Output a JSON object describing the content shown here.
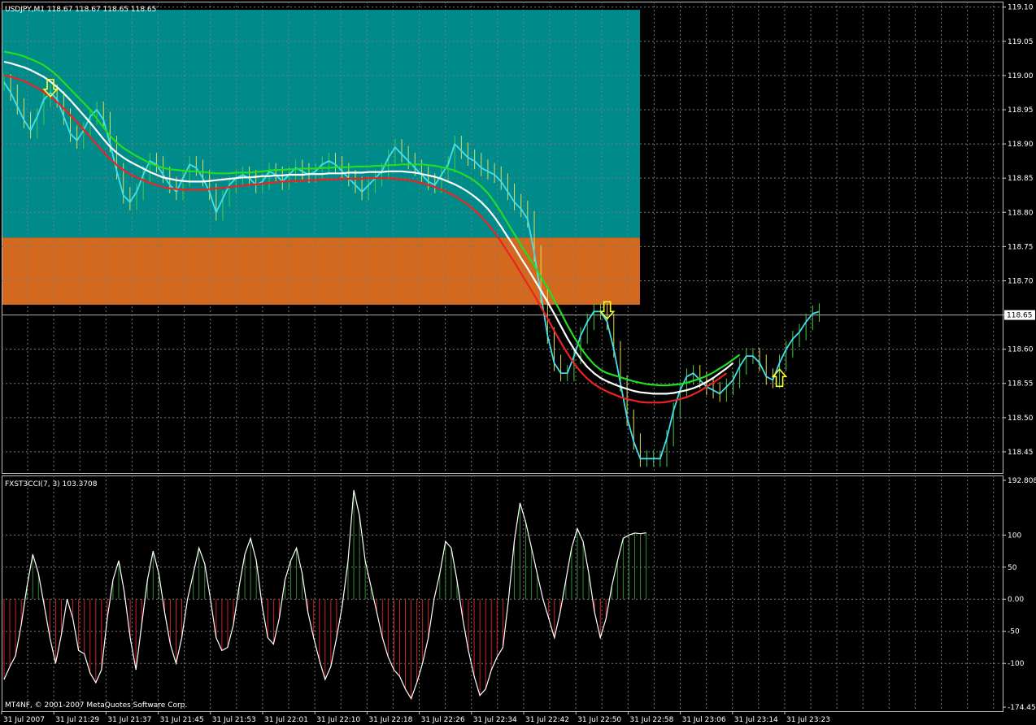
{
  "window": {
    "symbol_label": "USDJPY,M1  118.67 118.67 118.65 118.65",
    "indicator_label": "FXST3CCI(7, 3) 103.3708",
    "copyright": "MT4NF, © 2001-2007 MetaQuotes Software Corp."
  },
  "colors": {
    "background": "#000000",
    "grid": "#7a7a7a",
    "zone_upper": "#008b8b",
    "zone_lower": "#d2691e",
    "price_line": "#40e0f0",
    "ma_upper": "#22dd22",
    "ma_middle": "#ffffff",
    "ma_lower": "#ee2222",
    "bar_up": "#44cc44",
    "cci_line": "#ffffff",
    "cci_pos_hist": "#2e8b2e",
    "cci_neg_hist": "#cc2222",
    "arrow": "#ffff33"
  },
  "current_price_tag": "118.65",
  "price_axis": [
    "119.10",
    "119.05",
    "119.00",
    "118.95",
    "118.90",
    "118.85",
    "118.80",
    "118.75",
    "118.70",
    "118.65",
    "118.60",
    "118.55",
    "118.50",
    "118.45"
  ],
  "cci_axis": [
    "192.8083",
    "100",
    "50",
    "0.00",
    "-50",
    "-100",
    "-174.450"
  ],
  "time_axis": [
    "31 Jul 2007",
    "31 Jul 21:29",
    "31 Jul 21:37",
    "31 Jul 21:45",
    "31 Jul 21:53",
    "31 Jul 22:01",
    "31 Jul 22:10",
    "31 Jul 22:18",
    "31 Jul 22:26",
    "31 Jul 22:34",
    "31 Jul 22:42",
    "31 Jul 22:50",
    "31 Jul 22:58",
    "31 Jul 23:06",
    "31 Jul 23:14",
    "31 Jul 23:23"
  ],
  "chart_data": [
    {
      "type": "line",
      "title": "USDJPY,M1  118.67 118.67 118.65 118.65",
      "ylim": [
        118.419,
        119.108
      ],
      "zones": [
        {
          "name": "upper",
          "y_from": 119.096,
          "y_to": 118.763
        },
        {
          "name": "lower",
          "y_from": 118.763,
          "y_to": 118.665
        }
      ],
      "signals": [
        {
          "bar": 7,
          "price": 118.98,
          "direction": "down"
        },
        {
          "bar": 91,
          "price": 118.655,
          "direction": "down"
        },
        {
          "bar": 117,
          "price": 118.56,
          "direction": "up"
        }
      ],
      "series": [
        {
          "role": "price",
          "values": [
            118.99,
            118.975,
            118.955,
            118.935,
            118.92,
            118.94,
            118.965,
            118.975,
            118.965,
            118.94,
            118.915,
            118.905,
            118.92,
            118.94,
            118.95,
            118.935,
            118.9,
            118.86,
            118.825,
            118.815,
            118.83,
            118.855,
            118.875,
            118.87,
            118.855,
            118.84,
            118.83,
            118.85,
            118.87,
            118.865,
            118.85,
            118.83,
            118.8,
            118.82,
            118.84,
            118.85,
            118.855,
            118.85,
            118.84,
            118.845,
            118.86,
            118.855,
            118.845,
            118.855,
            118.865,
            118.86,
            118.855,
            118.86,
            118.87,
            118.875,
            118.87,
            118.86,
            118.85,
            118.84,
            118.83,
            118.84,
            118.85,
            118.86,
            118.88,
            118.895,
            118.885,
            118.875,
            118.865,
            118.855,
            118.845,
            118.84,
            118.855,
            118.87,
            118.9,
            118.89,
            118.88,
            118.875,
            118.865,
            118.86,
            118.855,
            118.845,
            118.83,
            118.815,
            118.805,
            118.79,
            118.74,
            118.68,
            118.62,
            118.58,
            118.565,
            118.565,
            118.59,
            118.62,
            118.64,
            118.655,
            118.655,
            118.64,
            118.6,
            118.55,
            118.5,
            118.465,
            118.44,
            118.44,
            118.44,
            118.44,
            118.47,
            118.51,
            118.54,
            118.56,
            118.565,
            118.555,
            118.545,
            118.54,
            118.535,
            118.545,
            118.555,
            118.575,
            118.59,
            118.59,
            118.58,
            118.56,
            118.555,
            118.58,
            118.6,
            118.615,
            118.625,
            118.64,
            118.652,
            118.655
          ]
        },
        {
          "role": "ma_upper",
          "values": [
            119.035,
            119.033,
            119.031,
            119.028,
            119.024,
            119.02,
            119.015,
            119.008,
            119.0,
            118.99,
            118.98,
            118.97,
            118.96,
            118.95,
            118.937,
            118.924,
            118.912,
            118.902,
            118.894,
            118.888,
            118.882,
            118.877,
            118.872,
            118.868,
            118.865,
            118.863,
            118.862,
            118.861,
            118.86,
            118.86,
            118.859,
            118.858,
            118.857,
            118.857,
            118.857,
            118.858,
            118.858,
            118.858,
            118.859,
            118.86,
            118.861,
            118.862,
            118.862,
            118.863,
            118.863,
            118.864,
            118.864,
            118.864,
            118.865,
            118.865,
            118.866,
            118.866,
            118.866,
            118.867,
            118.867,
            118.867,
            118.868,
            118.868,
            118.869,
            118.869,
            118.87,
            118.87,
            118.87,
            118.87,
            118.869,
            118.868,
            118.866,
            118.864,
            118.861,
            118.857,
            118.852,
            118.846,
            118.838,
            118.828,
            118.815,
            118.8,
            118.784,
            118.768,
            118.752,
            118.737,
            118.722,
            118.706,
            118.69,
            118.672,
            118.654,
            118.635,
            118.618,
            118.602,
            118.589,
            118.578,
            118.57,
            118.565,
            118.562,
            118.559,
            118.556,
            118.553,
            118.551,
            118.549,
            118.548,
            118.547,
            118.547,
            118.548,
            118.549,
            118.551,
            118.554,
            118.557,
            118.561,
            118.566,
            118.572,
            118.578,
            118.585,
            118.592
          ]
        },
        {
          "role": "ma_middle",
          "values": [
            119.02,
            119.018,
            119.015,
            119.012,
            119.008,
            119.003,
            118.998,
            118.991,
            118.983,
            118.974,
            118.964,
            118.953,
            118.942,
            118.931,
            118.919,
            118.907,
            118.896,
            118.887,
            118.88,
            118.874,
            118.869,
            118.864,
            118.859,
            118.855,
            118.851,
            118.849,
            118.847,
            118.846,
            118.845,
            118.845,
            118.845,
            118.846,
            118.847,
            118.848,
            118.849,
            118.85,
            118.851,
            118.851,
            118.852,
            118.853,
            118.853,
            118.854,
            118.854,
            118.855,
            118.855,
            118.855,
            118.856,
            118.856,
            118.856,
            118.857,
            118.857,
            118.857,
            118.858,
            118.858,
            118.858,
            118.859,
            118.859,
            118.859,
            118.86,
            118.86,
            118.86,
            118.859,
            118.858,
            118.856,
            118.854,
            118.852,
            118.849,
            118.845,
            118.841,
            118.836,
            118.83,
            118.823,
            118.815,
            118.805,
            118.793,
            118.779,
            118.764,
            118.749,
            118.733,
            118.718,
            118.702,
            118.686,
            118.669,
            118.652,
            118.634,
            118.616,
            118.6,
            118.586,
            118.574,
            118.565,
            118.558,
            118.553,
            118.549,
            118.545,
            118.542,
            118.539,
            118.537,
            118.536,
            118.535,
            118.535,
            118.535,
            118.536,
            118.538,
            118.54,
            118.543,
            118.547,
            118.552,
            118.558,
            118.565,
            118.572,
            118.58
          ]
        },
        {
          "role": "ma_lower",
          "values": [
            119.0,
            118.998,
            118.995,
            118.992,
            118.987,
            118.982,
            118.976,
            118.969,
            118.961,
            118.952,
            118.942,
            118.932,
            118.921,
            118.91,
            118.899,
            118.888,
            118.878,
            118.869,
            118.862,
            118.856,
            118.851,
            118.847,
            118.843,
            118.84,
            118.837,
            118.835,
            118.834,
            118.833,
            118.833,
            118.833,
            118.833,
            118.834,
            118.835,
            118.836,
            118.837,
            118.838,
            118.839,
            118.84,
            118.841,
            118.842,
            118.843,
            118.844,
            118.845,
            118.845,
            118.846,
            118.846,
            118.847,
            118.847,
            118.848,
            118.848,
            118.848,
            118.849,
            118.849,
            118.849,
            118.849,
            118.85,
            118.85,
            118.85,
            118.85,
            118.849,
            118.848,
            118.847,
            118.845,
            118.843,
            118.84,
            118.837,
            118.833,
            118.829,
            118.824,
            118.818,
            118.811,
            118.803,
            118.794,
            118.783,
            118.771,
            118.757,
            118.742,
            118.727,
            118.711,
            118.695,
            118.679,
            118.662,
            118.645,
            118.627,
            118.61,
            118.594,
            118.579,
            118.567,
            118.557,
            118.549,
            118.543,
            118.538,
            118.534,
            118.53,
            118.527,
            118.525,
            118.523,
            118.522,
            118.522,
            118.522,
            118.523,
            118.525,
            118.527,
            118.53,
            118.534,
            118.539,
            118.545,
            118.551,
            118.558,
            118.565
          ]
        }
      ]
    },
    {
      "type": "area",
      "title": "FXST3CCI(7, 3) 103.3708",
      "ylim": [
        -174.45,
        192.8083
      ],
      "series": [
        {
          "role": "cci",
          "values": [
            -125,
            -105,
            -88,
            -40,
            20,
            70,
            40,
            -10,
            -60,
            -100,
            -55,
            0,
            -30,
            -80,
            -85,
            -115,
            -130,
            -110,
            -30,
            30,
            60,
            10,
            -60,
            -110,
            -40,
            30,
            75,
            40,
            -20,
            -70,
            -100,
            -60,
            0,
            40,
            80,
            55,
            0,
            -60,
            -80,
            -75,
            -40,
            20,
            70,
            95,
            60,
            -10,
            -60,
            -70,
            -30,
            30,
            60,
            80,
            40,
            -20,
            -60,
            -95,
            -125,
            -105,
            -60,
            -10,
            60,
            170,
            130,
            60,
            20,
            -20,
            -60,
            -90,
            -110,
            -120,
            -140,
            -155,
            -130,
            -100,
            -60,
            0,
            40,
            90,
            80,
            30,
            -30,
            -80,
            -120,
            -150,
            -140,
            -110,
            -90,
            -75,
            0,
            90,
            150,
            120,
            80,
            40,
            0,
            -30,
            -60,
            -20,
            30,
            80,
            110,
            90,
            40,
            -20,
            -60,
            -30,
            20,
            60,
            95,
            100,
            103,
            102,
            103.37
          ]
        }
      ]
    }
  ]
}
